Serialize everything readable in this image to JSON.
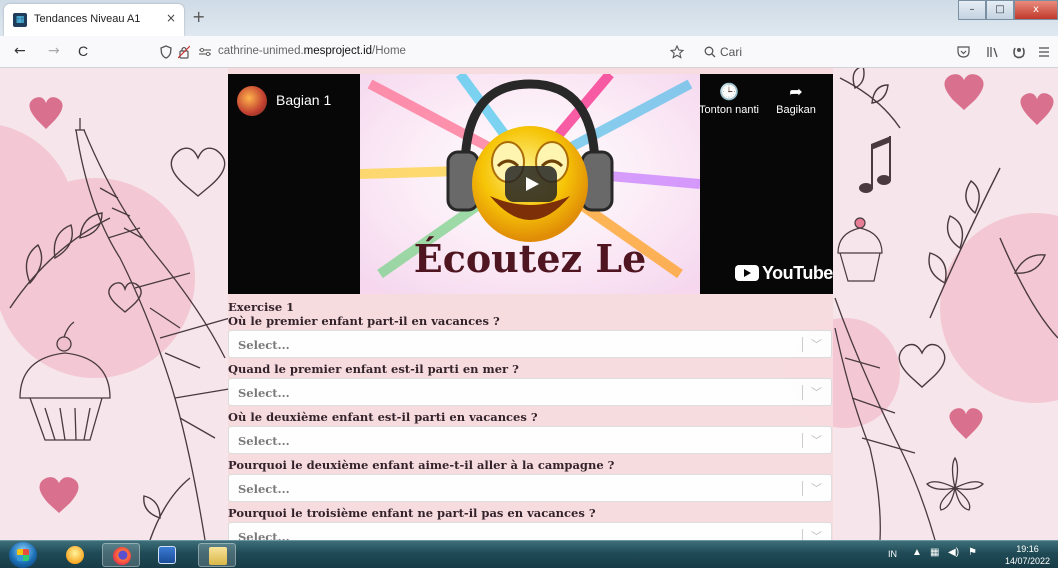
{
  "browser": {
    "tab_title": "Tendances Niveau A1",
    "tab_close": "×",
    "new_tab": "+",
    "win_min": "–",
    "win_max": "□",
    "win_close": "x",
    "back": "←",
    "forward": "→",
    "reload": "C",
    "url_prefix": "cathrine-unimed.",
    "url_domain": "mesproject.id",
    "url_path": "/Home",
    "search_placeholder": "Cari"
  },
  "video": {
    "title": "Bagian 1",
    "thumbnail_text": "Écoutez Le",
    "watch_later": "Tonton nanti",
    "share": "Bagikan",
    "brand": "YouTube"
  },
  "exercise": {
    "title": "Exercise 1",
    "select_placeholder": "Select...",
    "questions": [
      {
        "label": "Où le premier enfant part-il en vacances ?"
      },
      {
        "label": "Quand le premier enfant est-il parti en mer ?"
      },
      {
        "label": "Où le deuxième enfant est-il parti en vacances ?"
      },
      {
        "label": "Pourquoi le deuxième enfant aime-t-il aller à la campagne ?"
      },
      {
        "label": "Pourquoi le troisième enfant ne part-il pas en vacances ?"
      }
    ]
  },
  "taskbar": {
    "lang": "IN",
    "time": "19:16",
    "date": "14/07/2022"
  },
  "colors": {
    "page_bg": "#f6e5ea",
    "content_bg": "#f8dcdf",
    "heart": "#d9718e",
    "sketch": "#4a3a40"
  }
}
